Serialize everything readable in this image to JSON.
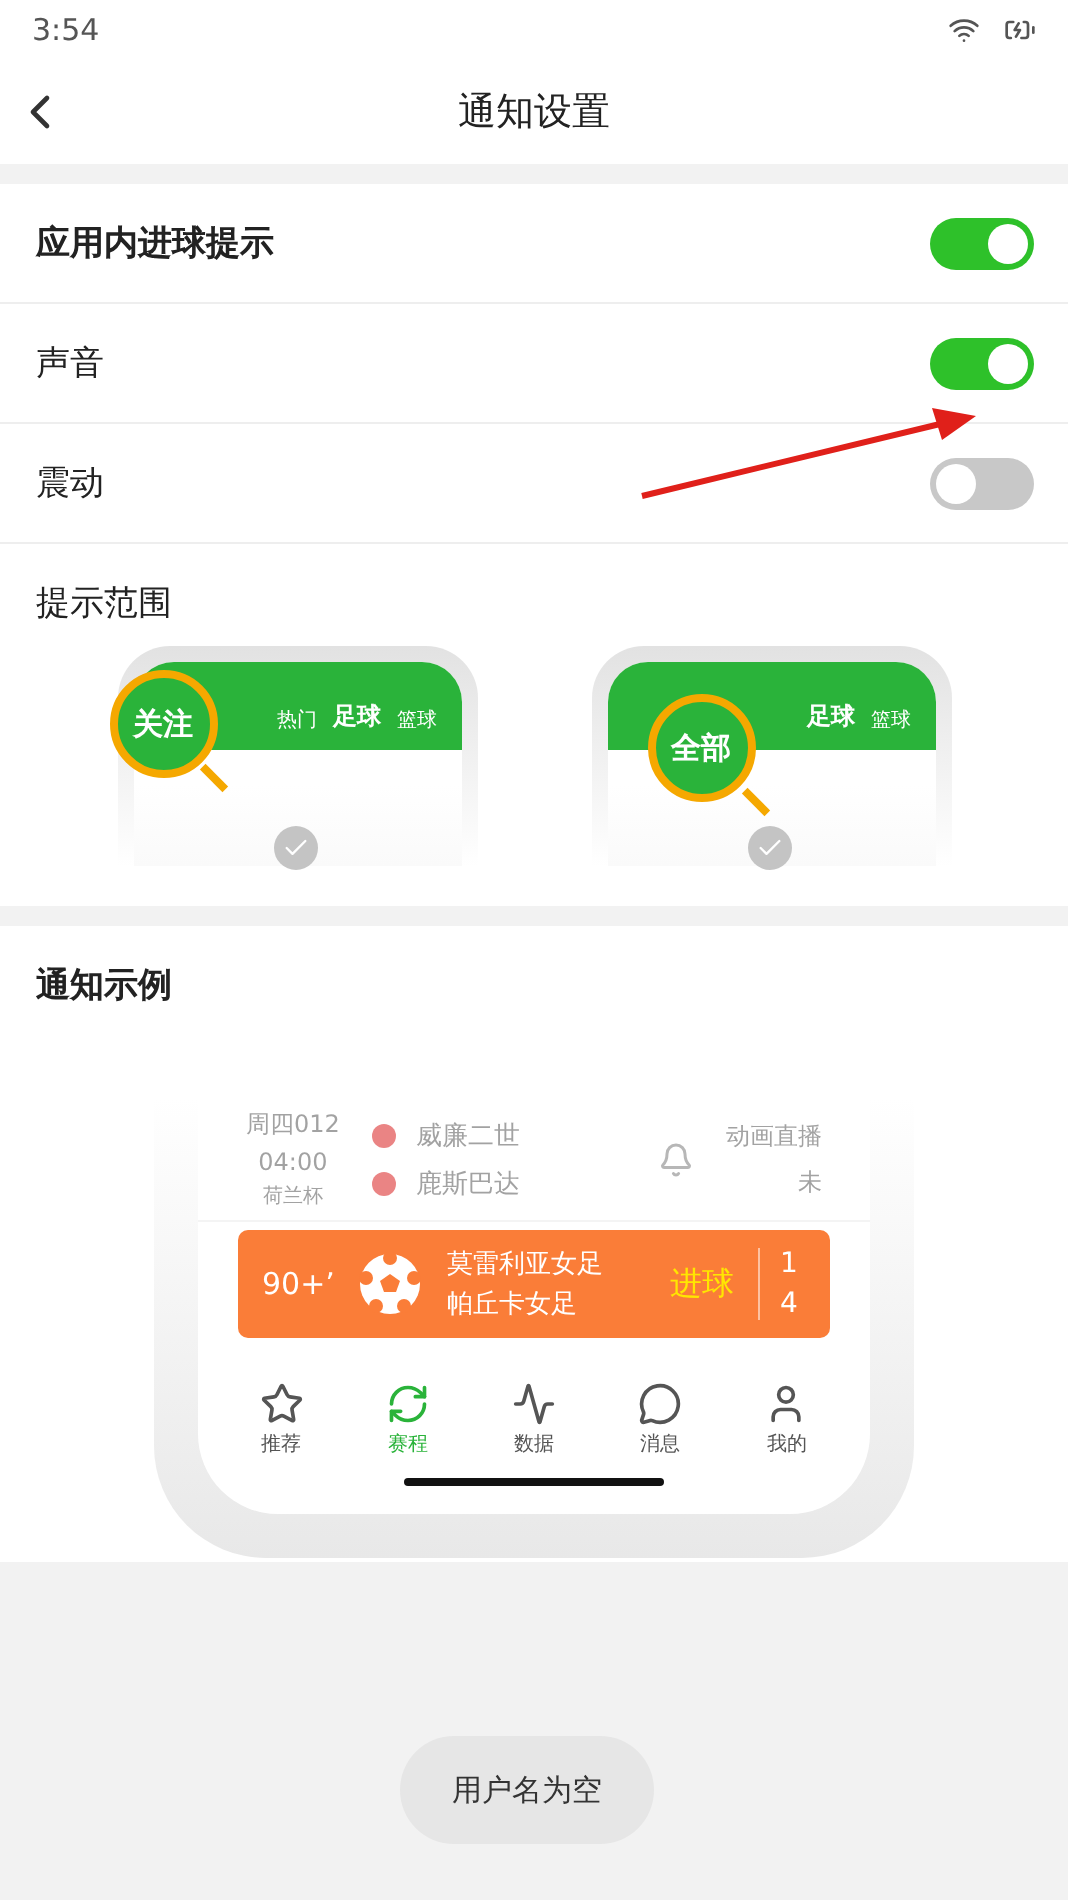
{
  "status_bar": {
    "time": "3:54"
  },
  "header": {
    "title": "通知设置"
  },
  "settings": [
    {
      "label": "应用内进球提示",
      "on": true,
      "kind": "header"
    },
    {
      "label": "声音",
      "on": true,
      "kind": "item"
    },
    {
      "label": "震动",
      "on": false,
      "kind": "item"
    }
  ],
  "scope": {
    "label": "提示范围",
    "options": [
      {
        "lens": "关注",
        "tabs": [
          "热门",
          "足球",
          "篮球"
        ],
        "selected": false
      },
      {
        "lens": "全部",
        "tabs": [
          "足球",
          "篮球"
        ],
        "selected": false
      }
    ]
  },
  "example": {
    "title": "通知示例",
    "match": {
      "code": "周四012",
      "time": "04:00",
      "league": "荷兰杯",
      "home": "威廉二世",
      "away": "鹿斯巴达",
      "live": "动画直播",
      "state": "未"
    },
    "goal": {
      "minute": "90+’",
      "home": "莫雷利亚女足",
      "away": "帕丘卡女足",
      "event": "进球",
      "home_score": "1",
      "away_score": "4"
    },
    "nav": [
      {
        "label": "推荐",
        "selected": false
      },
      {
        "label": "赛程",
        "selected": true
      },
      {
        "label": "数据",
        "selected": false
      },
      {
        "label": "消息",
        "selected": false
      },
      {
        "label": "我的",
        "selected": false
      }
    ]
  },
  "toast": "用户名为空"
}
